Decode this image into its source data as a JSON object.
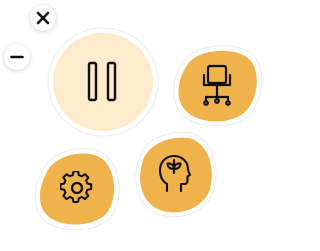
{
  "controls": {
    "close_icon": "close-icon",
    "minimize_icon": "minus-icon"
  },
  "actions": [
    {
      "id": "pause",
      "icon": "pause-icon"
    },
    {
      "id": "posture",
      "icon": "office-chair-icon"
    },
    {
      "id": "settings",
      "icon": "gear-icon"
    },
    {
      "id": "mindfulness",
      "icon": "head-leaf-icon"
    }
  ],
  "colors": {
    "accent": "#F0B24A",
    "pause_bg": "#FDEBCB",
    "halo": "#FFFFFF",
    "icon_stroke": "#111111"
  }
}
